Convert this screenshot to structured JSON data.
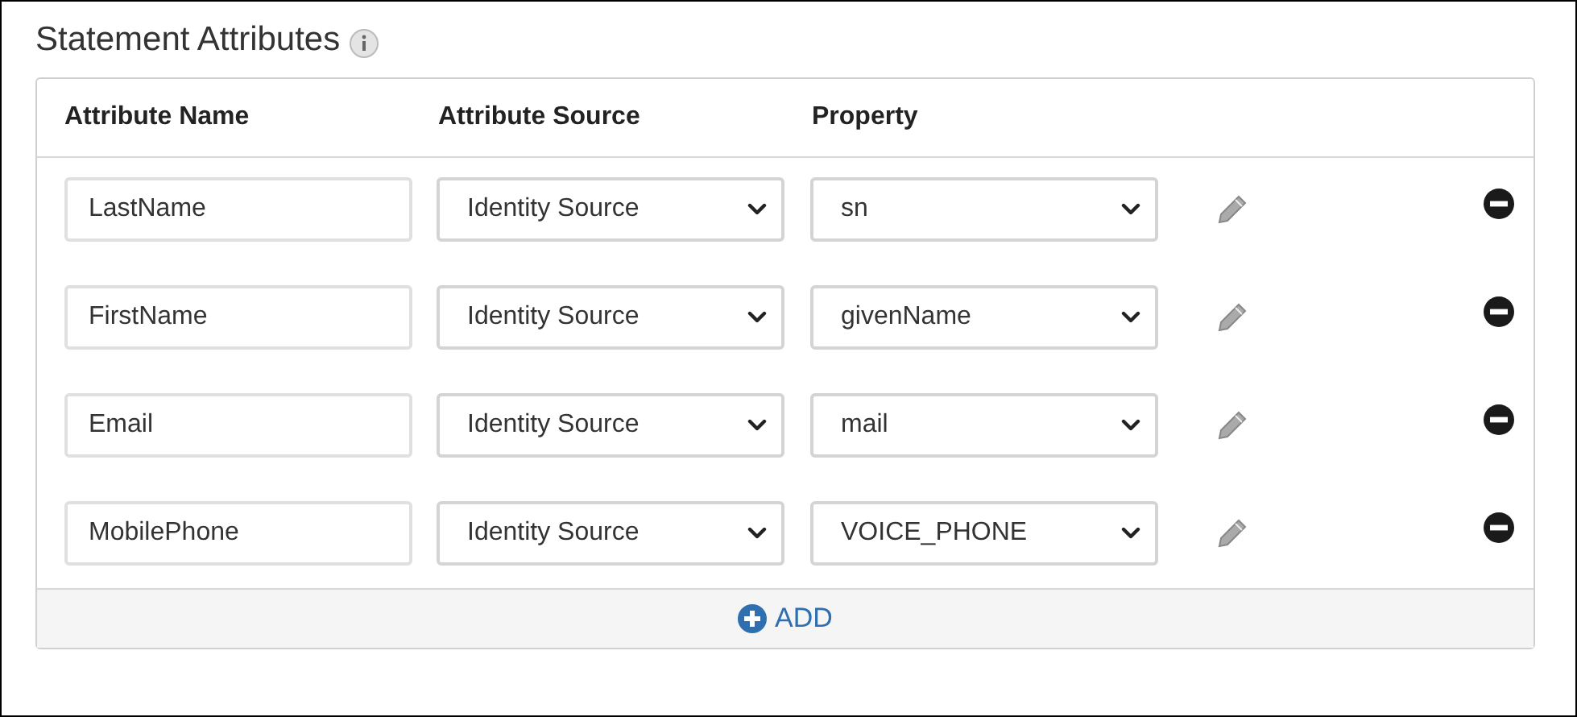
{
  "section": {
    "title": "Statement Attributes"
  },
  "table": {
    "columns": [
      "Attribute Name",
      "Attribute Source",
      "Property"
    ],
    "rows": [
      {
        "name": "LastName",
        "source": "Identity Source",
        "property": "sn"
      },
      {
        "name": "FirstName",
        "source": "Identity Source",
        "property": "givenName"
      },
      {
        "name": "Email",
        "source": "Identity Source",
        "property": "mail"
      },
      {
        "name": "MobilePhone",
        "source": "Identity Source",
        "property": "VOICE_PHONE"
      }
    ]
  },
  "add_button": {
    "label": "ADD"
  }
}
